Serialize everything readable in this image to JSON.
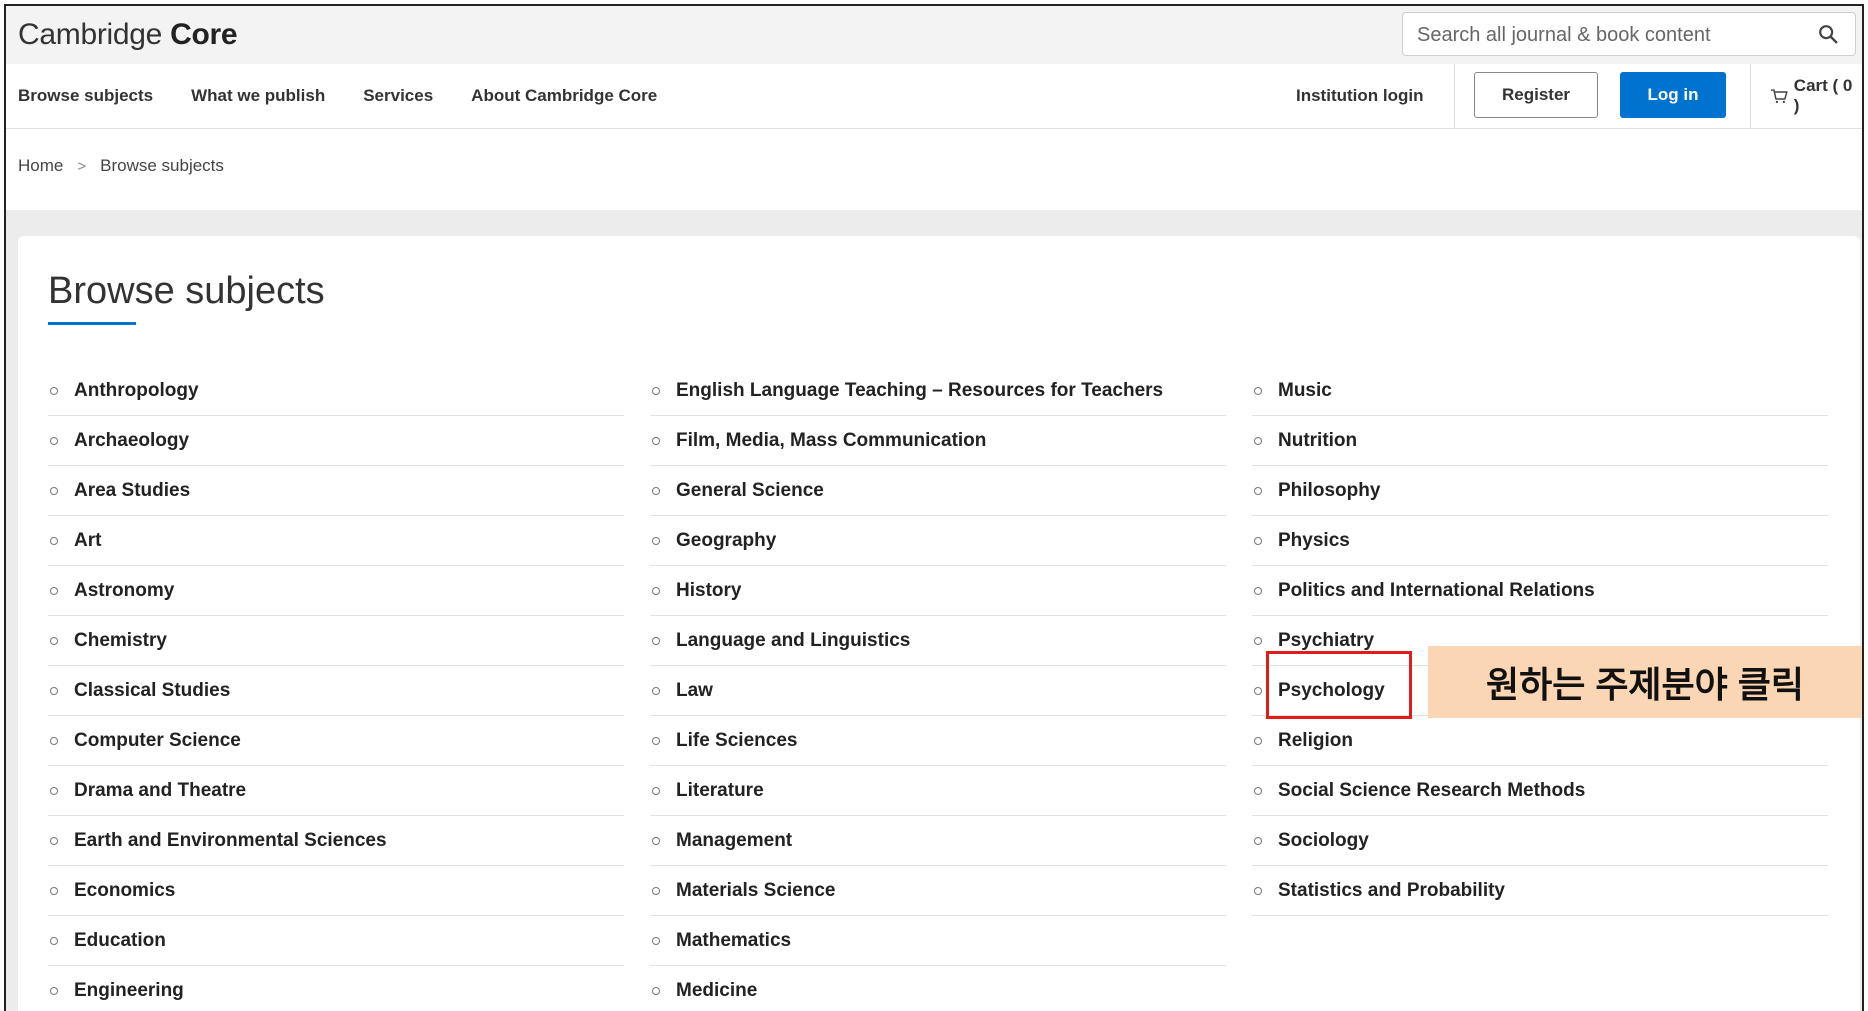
{
  "header": {
    "logo_text": "Cambridge ",
    "logo_bold": "Core",
    "search_placeholder": "Search all journal & book content"
  },
  "nav": {
    "links": [
      "Browse subjects",
      "What we publish",
      "Services",
      "About Cambridge Core"
    ],
    "institution_login": "Institution login",
    "register": "Register",
    "login": "Log in",
    "cart": "Cart ( 0 )"
  },
  "breadcrumb": {
    "home": "Home",
    "separator": ">",
    "current": "Browse subjects"
  },
  "main": {
    "title": "Browse subjects",
    "columns": [
      [
        "Anthropology",
        "Archaeology",
        "Area Studies",
        "Art",
        "Astronomy",
        "Chemistry",
        "Classical Studies",
        "Computer Science",
        "Drama and Theatre",
        "Earth and Environmental Sciences",
        "Economics",
        "Education",
        "Engineering"
      ],
      [
        "English Language Teaching – Resources for Teachers",
        "Film, Media, Mass Communication",
        "General Science",
        "Geography",
        "History",
        "Language and Linguistics",
        "Law",
        "Life Sciences",
        "Literature",
        "Management",
        "Materials Science",
        "Mathematics",
        "Medicine"
      ],
      [
        "Music",
        "Nutrition",
        "Philosophy",
        "Physics",
        "Politics and International Relations",
        "Psychiatry",
        "Psychology",
        "Religion",
        "Social Science Research Methods",
        "Sociology",
        "Statistics and Probability"
      ]
    ]
  },
  "annotation": {
    "callout_text": "원하는 주제분야 클릭",
    "highlighted_item": "Psychology"
  },
  "colors": {
    "accent_blue": "#0072cf",
    "highlight_red": "#e21b1b",
    "callout_bg": "#fbd6b5"
  }
}
